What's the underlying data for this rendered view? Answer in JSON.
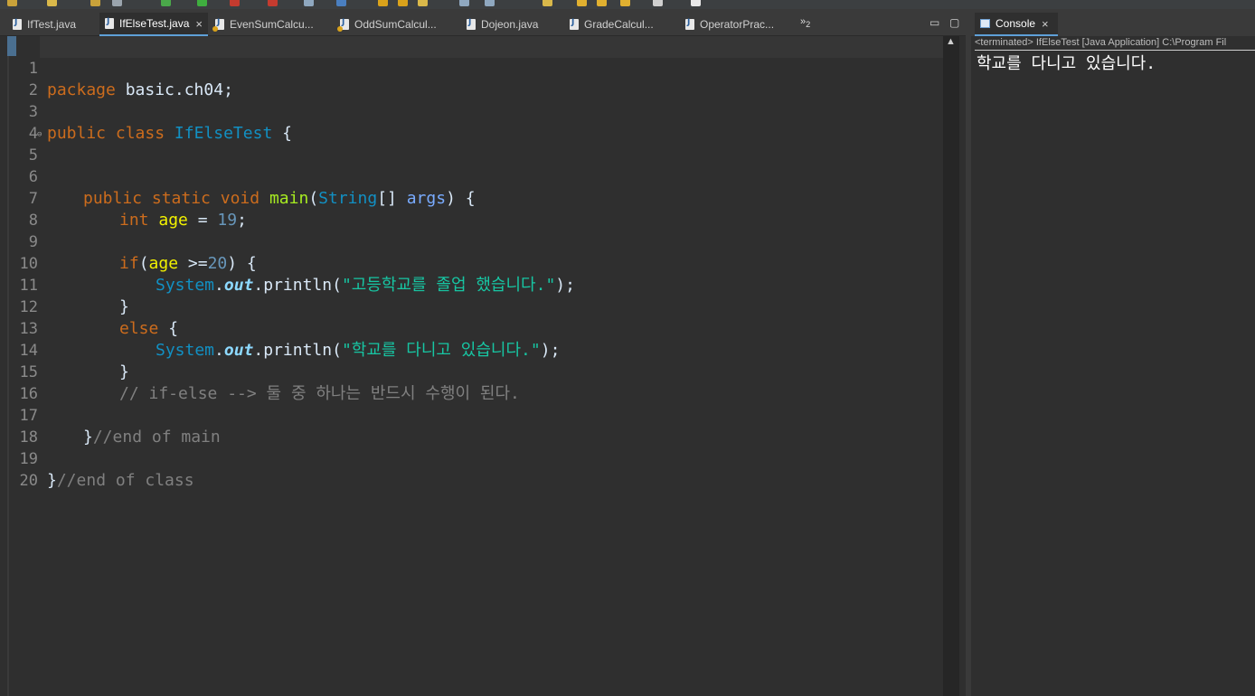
{
  "editor": {
    "tabs": [
      {
        "label": "IfTest.java",
        "active": false,
        "running": false
      },
      {
        "label": "IfElseTest.java",
        "active": true,
        "running": false
      },
      {
        "label": "EvenSumCalcu...",
        "active": false,
        "running": true
      },
      {
        "label": "OddSumCalcul...",
        "active": false,
        "running": true
      },
      {
        "label": "Dojeon.java",
        "active": false,
        "running": false
      },
      {
        "label": "GradeCalcul...",
        "active": false,
        "running": false
      },
      {
        "label": "OperatorPrac...",
        "active": false,
        "running": false
      }
    ],
    "close_glyph": "×",
    "overflow_label": "»",
    "overflow_count": "2",
    "minimize_glyph": "▭",
    "maximize_glyph": "▢",
    "line_numbers": [
      "1",
      "2",
      "3",
      "4",
      "5",
      "6",
      "7",
      "8",
      "9",
      "10",
      "11",
      "12",
      "13",
      "14",
      "15",
      "16",
      "17",
      "18",
      "19",
      "20"
    ],
    "fold_marker": "⊖",
    "code": {
      "l1": {
        "kw": "package",
        "text": " basic.ch04;"
      },
      "l3": {
        "kw1": "public",
        "kw2": "class",
        "cls": "IfElseTest",
        "brace": " {"
      },
      "l5": {
        "kw1": "public",
        "kw2": "static",
        "kw3": "void",
        "mth": "main",
        "open": "(",
        "cls": "String",
        "arr": "[] ",
        "par": "args",
        "close": ") {"
      },
      "l7": {
        "kw": "int",
        "var": "age",
        "eq": " = ",
        "num": "19",
        "semi": ";"
      },
      "l9": {
        "kw": "if",
        "open": "(",
        "var": "age",
        "op": " >=",
        "num": "20",
        "close": ") {"
      },
      "l10": {
        "cls": "System",
        "dot1": ".",
        "fld": "out",
        "rest": ".println(",
        "str": "\"고등학교를 졸업 했습니다.\"",
        "end": ");"
      },
      "l11": {
        "text": "}"
      },
      "l12": {
        "kw": "else",
        "brace": " {"
      },
      "l13": {
        "cls": "System",
        "dot1": ".",
        "fld": "out",
        "rest": ".println(",
        "str": "\"학교를 다니고 있습니다.\"",
        "end": ");"
      },
      "l14": {
        "text": "}"
      },
      "l15": {
        "cmt": "// if-else --> 둘 중 하나는 반드시 수행이 된다."
      },
      "l17": {
        "brace": "}",
        "cmt": "//end of main"
      },
      "l19": {
        "brace": "}",
        "cmt": "//end of class"
      }
    }
  },
  "console": {
    "tab_label": "Console",
    "close_glyph": "×",
    "status": "<terminated> IfElseTest [Java Application] C:\\Program Fil",
    "output": "학교를 다니고 있습니다."
  },
  "colors": {
    "keyword": "#cc6c1d",
    "class": "#1290c3",
    "variable": "#f2f200",
    "string": "#17c6a3",
    "comment": "#808080",
    "number": "#6897bb",
    "background": "#2f2f2f"
  }
}
